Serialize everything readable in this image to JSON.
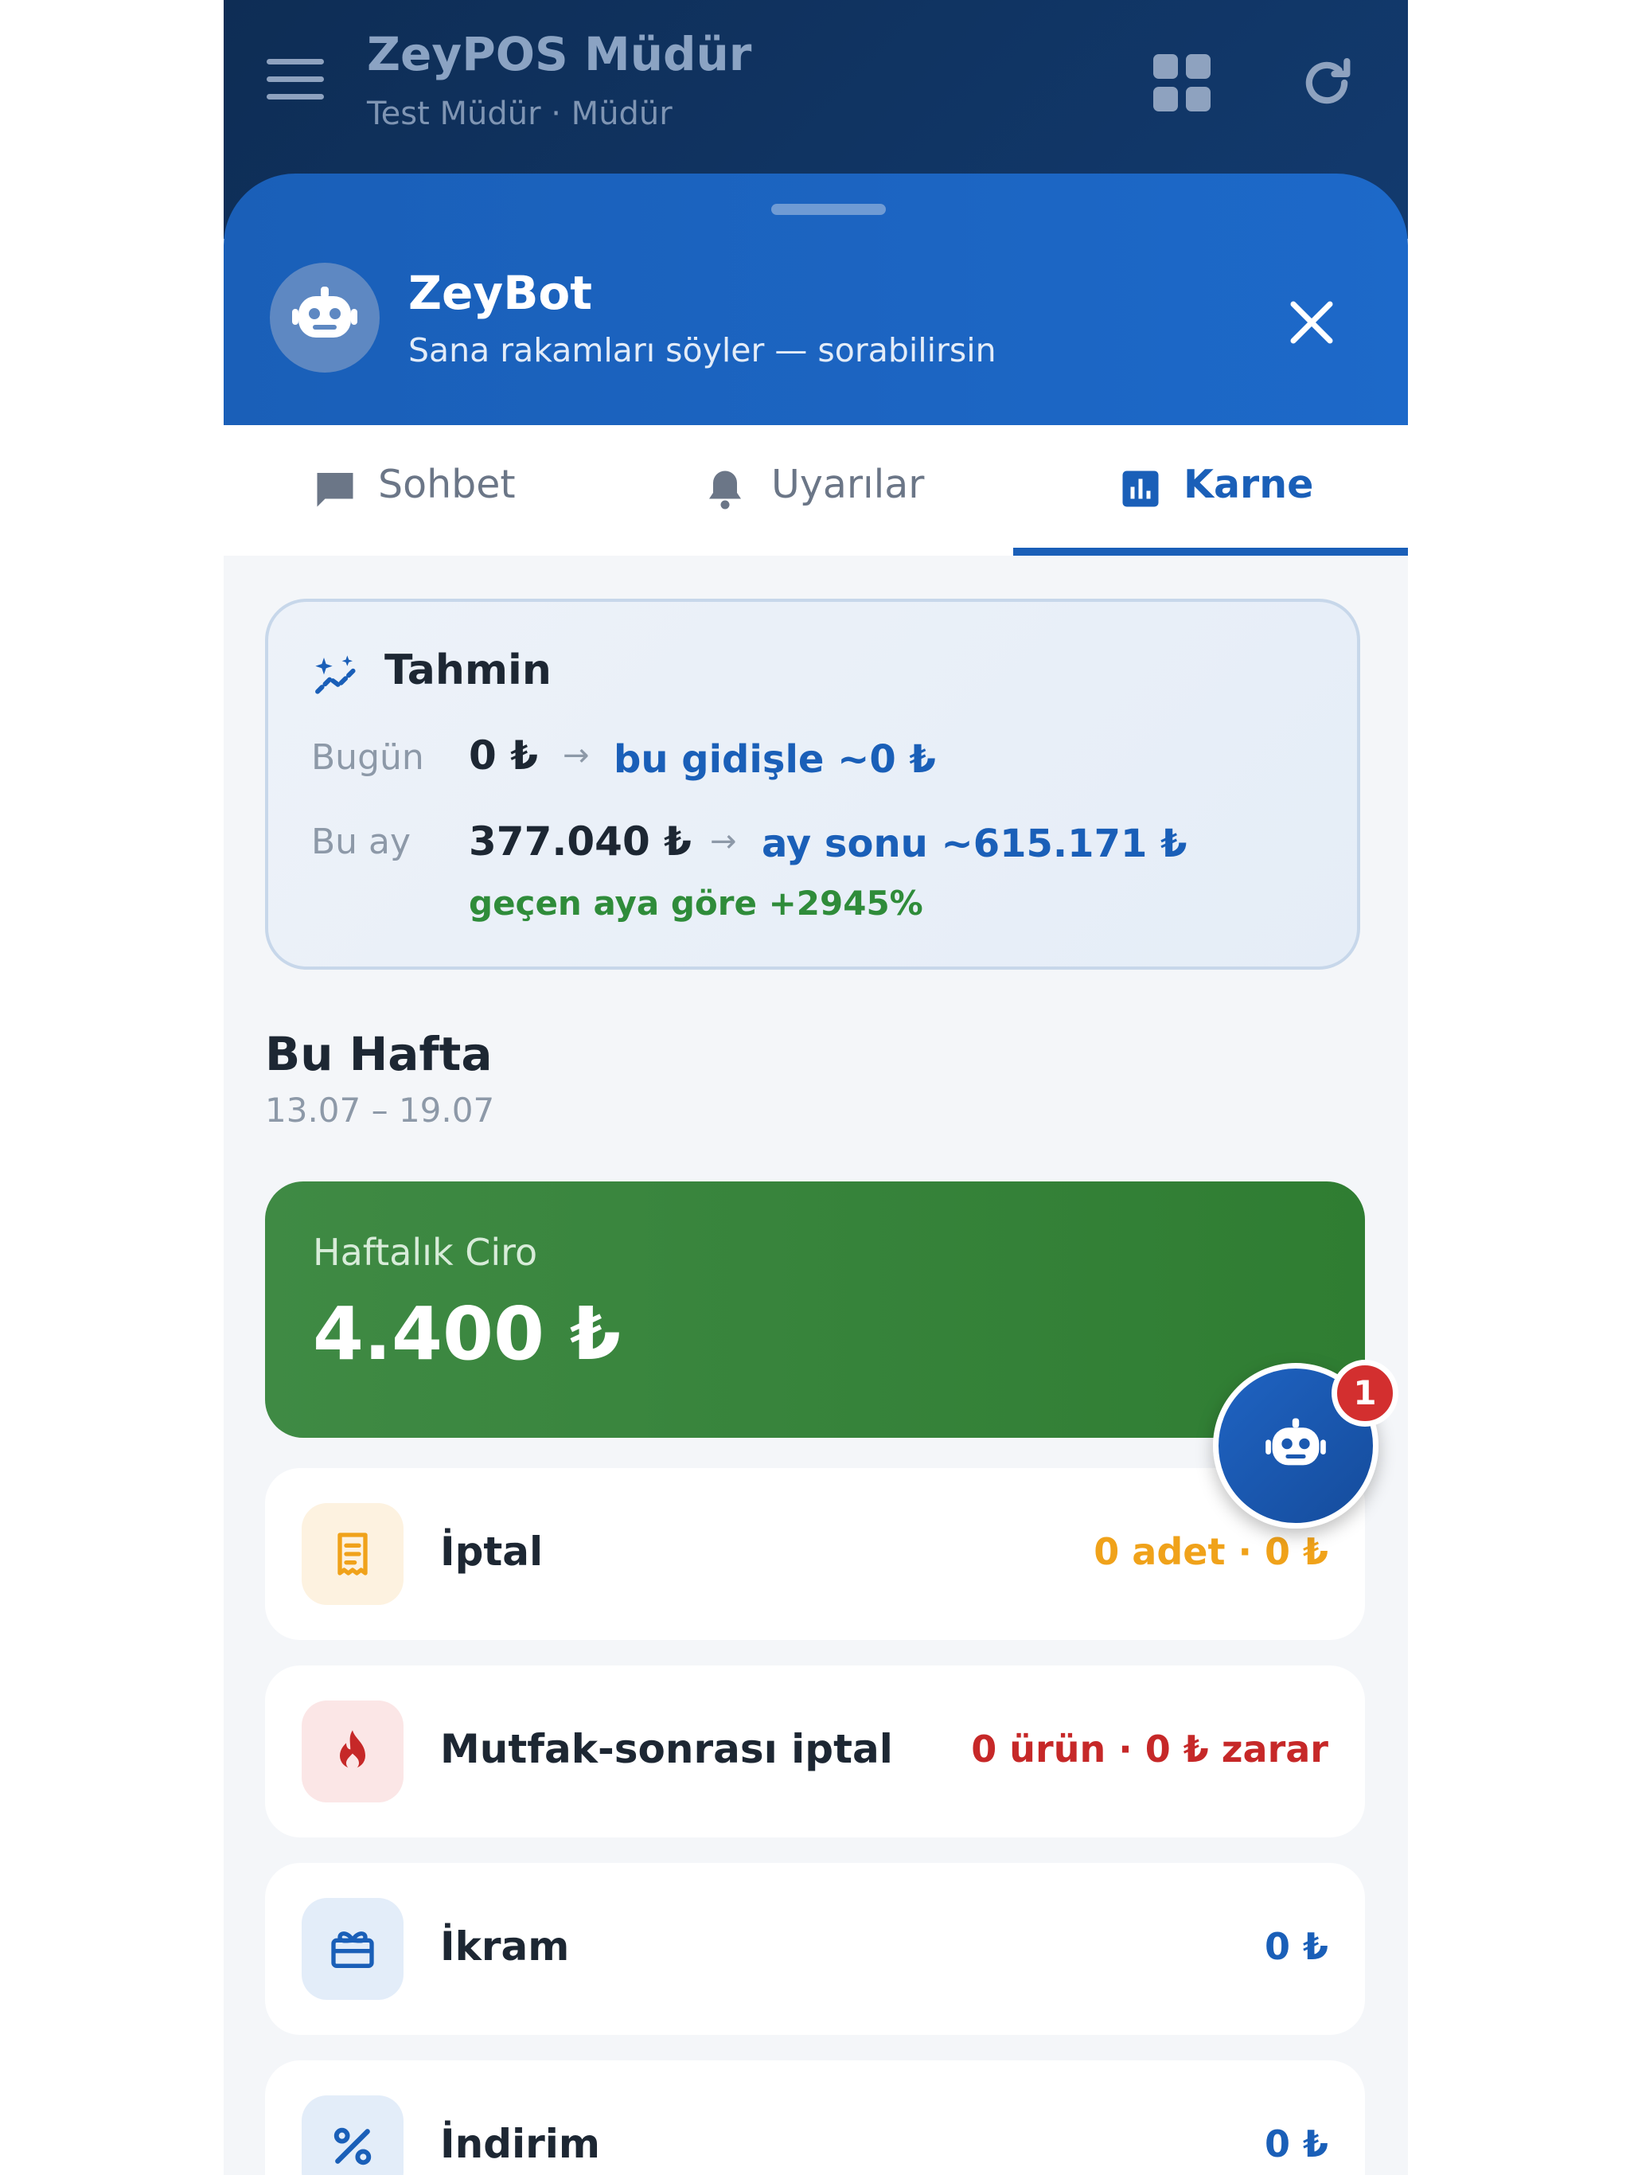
{
  "app": {
    "title": "ZeyPOS Müdür",
    "subtitle": "Test Müdür · Müdür",
    "icons": [
      "menu-icon",
      "apps-grid-icon",
      "refresh-icon"
    ]
  },
  "bot": {
    "name": "ZeyBot",
    "tagline": "Sana rakamları söyler — sorabilirsin",
    "icons": [
      "robot-icon",
      "close-icon"
    ]
  },
  "tabs": [
    {
      "label": "Sohbet",
      "icon": "chat-icon",
      "active": false
    },
    {
      "label": "Uyarılar",
      "icon": "bell-icon",
      "active": false
    },
    {
      "label": "Karne",
      "icon": "bar-chart-icon",
      "active": true
    }
  ],
  "forecast": {
    "title": "Tahmin",
    "icon": "sparkle-trend-icon",
    "today": {
      "label": "Bugün",
      "value": "0 ₺",
      "projection": "bu gidişle ~0 ₺"
    },
    "month": {
      "label": "Bu ay",
      "value": "377.040 ₺",
      "projection": "ay sonu ~615.171 ₺",
      "change": "geçen aya göre +2945%"
    }
  },
  "week": {
    "title": "Bu Hafta",
    "dates": "13.07 – 19.07",
    "revenue": {
      "label": "Haftalık Ciro",
      "value": "4.400 ₺"
    },
    "stats": [
      {
        "label": "İptal",
        "value": "0 adet · 0 ₺",
        "icon": "receipt-icon",
        "color": "#f0a21a",
        "bg": "#fdf2e0"
      },
      {
        "label": "Mutfak-sonrası iptal",
        "value": "0 ürün · 0 ₺ zarar",
        "icon": "flame-icon",
        "color": "#c62828",
        "bg": "#fbe6e6"
      },
      {
        "label": "İkram",
        "value": "0 ₺",
        "icon": "gift-icon",
        "color": "#1a5fb8",
        "bg": "#e3edf9"
      },
      {
        "label": "İndirim",
        "value": "0 ₺",
        "icon": "percent-icon",
        "color": "#1a5fb8",
        "bg": "#e3edf9"
      }
    ]
  },
  "fab": {
    "badge": "1",
    "icon": "robot-icon"
  },
  "colors": {
    "primary": "#1a5fb8",
    "appbar": "#0e2d55",
    "success": "#2f7d32",
    "warning": "#f0a21a",
    "danger": "#c62828"
  }
}
